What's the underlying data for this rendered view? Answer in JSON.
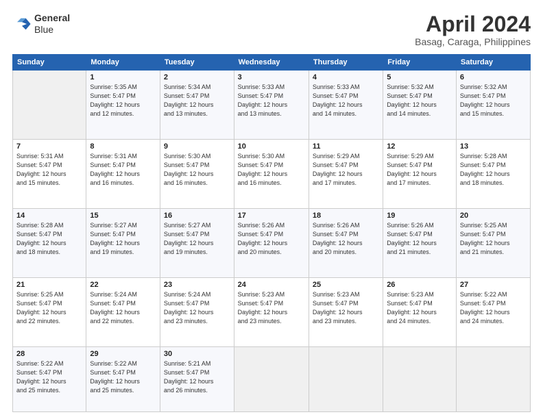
{
  "header": {
    "logo_line1": "General",
    "logo_line2": "Blue",
    "month": "April 2024",
    "location": "Basag, Caraga, Philippines"
  },
  "weekdays": [
    "Sunday",
    "Monday",
    "Tuesday",
    "Wednesday",
    "Thursday",
    "Friday",
    "Saturday"
  ],
  "weeks": [
    [
      {
        "day": "",
        "info": ""
      },
      {
        "day": "1",
        "info": "Sunrise: 5:35 AM\nSunset: 5:47 PM\nDaylight: 12 hours\nand 12 minutes."
      },
      {
        "day": "2",
        "info": "Sunrise: 5:34 AM\nSunset: 5:47 PM\nDaylight: 12 hours\nand 13 minutes."
      },
      {
        "day": "3",
        "info": "Sunrise: 5:33 AM\nSunset: 5:47 PM\nDaylight: 12 hours\nand 13 minutes."
      },
      {
        "day": "4",
        "info": "Sunrise: 5:33 AM\nSunset: 5:47 PM\nDaylight: 12 hours\nand 14 minutes."
      },
      {
        "day": "5",
        "info": "Sunrise: 5:32 AM\nSunset: 5:47 PM\nDaylight: 12 hours\nand 14 minutes."
      },
      {
        "day": "6",
        "info": "Sunrise: 5:32 AM\nSunset: 5:47 PM\nDaylight: 12 hours\nand 15 minutes."
      }
    ],
    [
      {
        "day": "7",
        "info": "Sunrise: 5:31 AM\nSunset: 5:47 PM\nDaylight: 12 hours\nand 15 minutes."
      },
      {
        "day": "8",
        "info": "Sunrise: 5:31 AM\nSunset: 5:47 PM\nDaylight: 12 hours\nand 16 minutes."
      },
      {
        "day": "9",
        "info": "Sunrise: 5:30 AM\nSunset: 5:47 PM\nDaylight: 12 hours\nand 16 minutes."
      },
      {
        "day": "10",
        "info": "Sunrise: 5:30 AM\nSunset: 5:47 PM\nDaylight: 12 hours\nand 16 minutes."
      },
      {
        "day": "11",
        "info": "Sunrise: 5:29 AM\nSunset: 5:47 PM\nDaylight: 12 hours\nand 17 minutes."
      },
      {
        "day": "12",
        "info": "Sunrise: 5:29 AM\nSunset: 5:47 PM\nDaylight: 12 hours\nand 17 minutes."
      },
      {
        "day": "13",
        "info": "Sunrise: 5:28 AM\nSunset: 5:47 PM\nDaylight: 12 hours\nand 18 minutes."
      }
    ],
    [
      {
        "day": "14",
        "info": "Sunrise: 5:28 AM\nSunset: 5:47 PM\nDaylight: 12 hours\nand 18 minutes."
      },
      {
        "day": "15",
        "info": "Sunrise: 5:27 AM\nSunset: 5:47 PM\nDaylight: 12 hours\nand 19 minutes."
      },
      {
        "day": "16",
        "info": "Sunrise: 5:27 AM\nSunset: 5:47 PM\nDaylight: 12 hours\nand 19 minutes."
      },
      {
        "day": "17",
        "info": "Sunrise: 5:26 AM\nSunset: 5:47 PM\nDaylight: 12 hours\nand 20 minutes."
      },
      {
        "day": "18",
        "info": "Sunrise: 5:26 AM\nSunset: 5:47 PM\nDaylight: 12 hours\nand 20 minutes."
      },
      {
        "day": "19",
        "info": "Sunrise: 5:26 AM\nSunset: 5:47 PM\nDaylight: 12 hours\nand 21 minutes."
      },
      {
        "day": "20",
        "info": "Sunrise: 5:25 AM\nSunset: 5:47 PM\nDaylight: 12 hours\nand 21 minutes."
      }
    ],
    [
      {
        "day": "21",
        "info": "Sunrise: 5:25 AM\nSunset: 5:47 PM\nDaylight: 12 hours\nand 22 minutes."
      },
      {
        "day": "22",
        "info": "Sunrise: 5:24 AM\nSunset: 5:47 PM\nDaylight: 12 hours\nand 22 minutes."
      },
      {
        "day": "23",
        "info": "Sunrise: 5:24 AM\nSunset: 5:47 PM\nDaylight: 12 hours\nand 23 minutes."
      },
      {
        "day": "24",
        "info": "Sunrise: 5:23 AM\nSunset: 5:47 PM\nDaylight: 12 hours\nand 23 minutes."
      },
      {
        "day": "25",
        "info": "Sunrise: 5:23 AM\nSunset: 5:47 PM\nDaylight: 12 hours\nand 23 minutes."
      },
      {
        "day": "26",
        "info": "Sunrise: 5:23 AM\nSunset: 5:47 PM\nDaylight: 12 hours\nand 24 minutes."
      },
      {
        "day": "27",
        "info": "Sunrise: 5:22 AM\nSunset: 5:47 PM\nDaylight: 12 hours\nand 24 minutes."
      }
    ],
    [
      {
        "day": "28",
        "info": "Sunrise: 5:22 AM\nSunset: 5:47 PM\nDaylight: 12 hours\nand 25 minutes."
      },
      {
        "day": "29",
        "info": "Sunrise: 5:22 AM\nSunset: 5:47 PM\nDaylight: 12 hours\nand 25 minutes."
      },
      {
        "day": "30",
        "info": "Sunrise: 5:21 AM\nSunset: 5:47 PM\nDaylight: 12 hours\nand 26 minutes."
      },
      {
        "day": "",
        "info": ""
      },
      {
        "day": "",
        "info": ""
      },
      {
        "day": "",
        "info": ""
      },
      {
        "day": "",
        "info": ""
      }
    ]
  ]
}
